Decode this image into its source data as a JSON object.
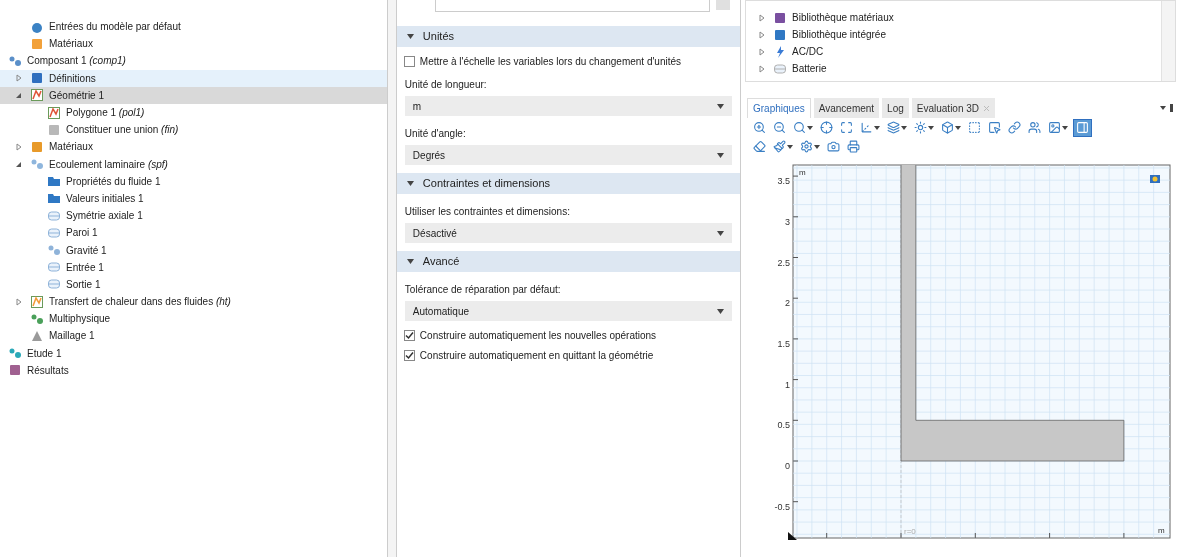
{
  "model_tree": [
    {
      "children": [
        {
          "label": "Entrées du modèle par défaut",
          "kind": "inputs",
          "selected": false,
          "hovered": false
        },
        {
          "label": "Matériaux",
          "kind": "materials",
          "selected": false,
          "hovered": false
        }
      ]
    },
    {
      "label": "Composant 1 *(comp1)*",
      "kind": "component",
      "selected": false,
      "hovered": false,
      "children": [
        {
          "label": "Définitions",
          "kind": "definitions",
          "expanded": false,
          "selected": false,
          "hovered": true
        },
        {
          "label": "Géométrie 1",
          "kind": "geometry",
          "expanded": true,
          "selected": true,
          "hovered": false,
          "children": [
            {
              "label": "Polygone 1 *(pol1)*",
              "kind": "polygon",
              "selected": false,
              "hovered": false
            },
            {
              "label": "Constituer une union  *(fin)*",
              "kind": "union",
              "selected": false,
              "hovered": false
            }
          ]
        },
        {
          "label": "Matériaux",
          "kind": "material",
          "expanded": false,
          "selected": false,
          "hovered": false
        },
        {
          "label": "Ecoulement laminaire *(spf)*",
          "kind": "flow",
          "expanded": true,
          "selected": false,
          "hovered": false,
          "children": [
            {
              "label": "Propriétés du fluide 1",
              "kind": "fluid",
              "selected": false,
              "hovered": false
            },
            {
              "label": "Valeurs initiales 1",
              "kind": "fluid",
              "selected": false,
              "hovered": false
            },
            {
              "label": "Symétrie axiale 1",
              "kind": "boundary",
              "selected": false,
              "hovered": false
            },
            {
              "label": "Paroi 1",
              "kind": "boundary",
              "selected": false,
              "hovered": false
            },
            {
              "label": "Gravité 1",
              "kind": "gravity",
              "selected": false,
              "hovered": false
            },
            {
              "label": "Entrée 1",
              "kind": "port",
              "selected": false,
              "hovered": false
            },
            {
              "label": "Sortie 1",
              "kind": "port",
              "selected": false,
              "hovered": false
            }
          ]
        },
        {
          "label": "Transfert de chaleur dans des fluides *(ht)*",
          "kind": "heat",
          "expanded": false,
          "selected": false,
          "hovered": false
        },
        {
          "label": "Multiphysique",
          "kind": "multiphysics",
          "selected": false,
          "hovered": false
        },
        {
          "label": "Maillage 1",
          "kind": "mesh",
          "selected": false,
          "hovered": false
        }
      ]
    },
    {
      "label": "Etude 1",
      "kind": "study",
      "selected": false,
      "hovered": false
    },
    {
      "label": "Résultats",
      "kind": "results",
      "selected": false,
      "hovered": false
    }
  ],
  "settings": {
    "sections": [
      {
        "title": "Unités",
        "expanded": true,
        "rows": [
          {
            "kind": "checkbox",
            "label": "Mettre à l'échelle les variables lors du changement d'unités",
            "checked": false
          },
          {
            "kind": "label",
            "label": "Unité de longueur:"
          },
          {
            "kind": "select",
            "value": "m"
          },
          {
            "kind": "label",
            "label": "Unité d'angle:"
          },
          {
            "kind": "select",
            "value": "Degrés"
          }
        ]
      },
      {
        "title": "Contraintes et dimensions",
        "expanded": true,
        "rows": [
          {
            "kind": "label",
            "label": "Utiliser les contraintes et dimensions:"
          },
          {
            "kind": "select",
            "value": "Désactivé"
          }
        ]
      },
      {
        "title": "Avancé",
        "expanded": true,
        "rows": [
          {
            "kind": "label",
            "label": "Tolérance de réparation par défaut:"
          },
          {
            "kind": "select",
            "value": "Automatique"
          },
          {
            "kind": "checkbox",
            "label": "Construire automatiquement les nouvelles opérations",
            "checked": true
          },
          {
            "kind": "checkbox",
            "label": "Construire automatiquement en quittant la géométrie",
            "checked": true
          }
        ]
      }
    ]
  },
  "library_tree": [
    {
      "label": "Bibliothèque matériaux",
      "kind": "books",
      "expanded": false
    },
    {
      "label": "Bibliothèque intégrée",
      "kind": "builtin",
      "expanded": false
    },
    {
      "label": "AC/DC",
      "kind": "acdc",
      "expanded": false
    },
    {
      "label": "Batterie",
      "kind": "battery",
      "expanded": false
    }
  ],
  "tabs": [
    {
      "label": "Graphiques",
      "selected": true,
      "closable": false
    },
    {
      "label": "Avancement",
      "selected": false,
      "closable": false
    },
    {
      "label": "Log",
      "selected": false,
      "closable": false
    },
    {
      "label": "Evaluation 3D",
      "selected": false,
      "closable": true
    }
  ],
  "toolbar": [
    [
      {
        "kind": "zoom-in",
        "dropdown": false,
        "on": false
      },
      {
        "kind": "zoom-out",
        "dropdown": false,
        "on": false
      },
      {
        "kind": "zoom-box",
        "dropdown": true,
        "on": false
      },
      {
        "kind": "center",
        "dropdown": false,
        "on": false
      },
      {
        "kind": "extents",
        "dropdown": false,
        "on": false
      },
      {
        "kind": "axes",
        "dropdown": true,
        "on": false
      },
      {
        "kind": "layers",
        "dropdown": true,
        "on": false
      },
      {
        "kind": "light",
        "dropdown": true,
        "on": false
      },
      {
        "kind": "box",
        "dropdown": true,
        "on": false
      },
      {
        "kind": "select",
        "dropdown": false,
        "on": false
      },
      {
        "kind": "select-all",
        "dropdown": false,
        "on": false
      },
      {
        "kind": "link",
        "dropdown": false,
        "on": false
      },
      {
        "kind": "users",
        "dropdown": false,
        "on": false
      },
      {
        "kind": "image",
        "dropdown": true,
        "on": false
      },
      {
        "kind": "panel",
        "dropdown": false,
        "on": true
      }
    ],
    [
      {
        "kind": "eraser",
        "dropdown": false,
        "on": false
      },
      {
        "kind": "brush",
        "dropdown": true,
        "on": false
      },
      {
        "kind": "gear",
        "dropdown": true,
        "on": false
      },
      {
        "kind": "camera",
        "dropdown": false,
        "on": false
      },
      {
        "kind": "printer",
        "dropdown": false,
        "on": false
      }
    ]
  ],
  "graphics": {
    "y_tick_labels": [
      "3.5",
      "3",
      "2.5",
      "2",
      "1.5",
      "1",
      "0.5",
      "0",
      "-0.5"
    ],
    "y_unit": "m",
    "x_unit": "m",
    "axis_label": "r=0"
  }
}
